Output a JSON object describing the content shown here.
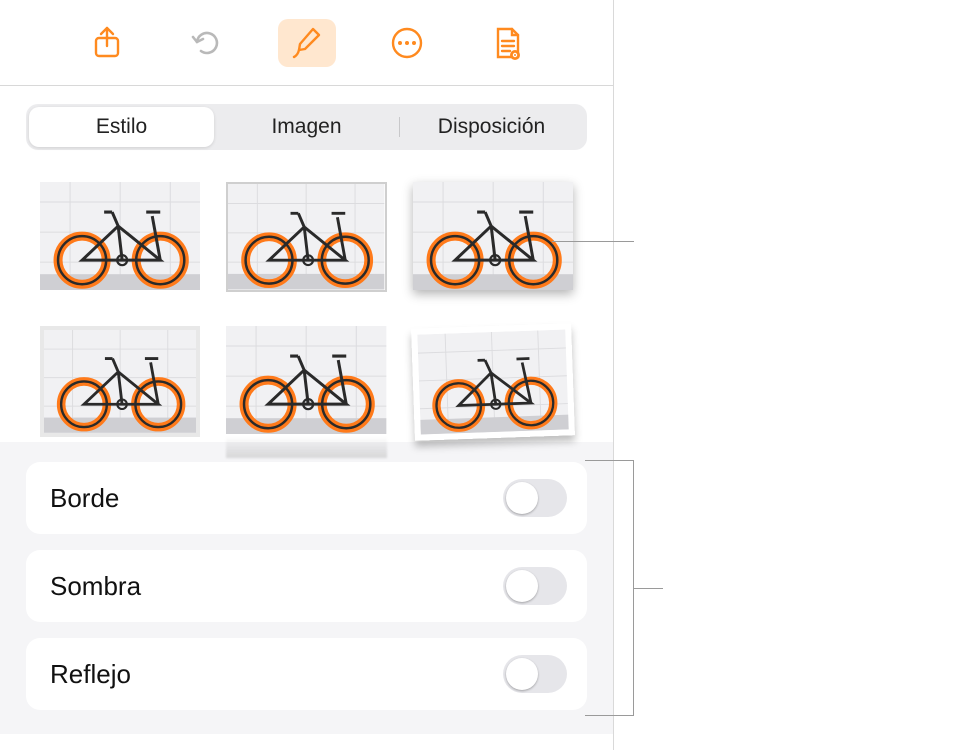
{
  "toolbar": {
    "share_icon": "share-icon",
    "undo_icon": "undo-icon",
    "format_icon": "paintbrush-icon",
    "more_icon": "ellipsis-icon",
    "doc_icon": "document-icon"
  },
  "tabs": [
    {
      "id": "estilo",
      "label": "Estilo",
      "selected": true
    },
    {
      "id": "imagen",
      "label": "Imagen",
      "selected": false
    },
    {
      "id": "disposicion",
      "label": "Disposición",
      "selected": false
    }
  ],
  "style_presets": [
    {
      "id": "preset-plain"
    },
    {
      "id": "preset-thin-border"
    },
    {
      "id": "preset-drop-shadow"
    },
    {
      "id": "preset-inset-frame"
    },
    {
      "id": "preset-reflection"
    },
    {
      "id": "preset-polaroid-tilt"
    }
  ],
  "options": [
    {
      "id": "borde",
      "label": "Borde",
      "on": false
    },
    {
      "id": "sombra",
      "label": "Sombra",
      "on": false
    },
    {
      "id": "reflejo",
      "label": "Reflejo",
      "on": false
    }
  ],
  "colors": {
    "accent": "#ff8a1f"
  }
}
